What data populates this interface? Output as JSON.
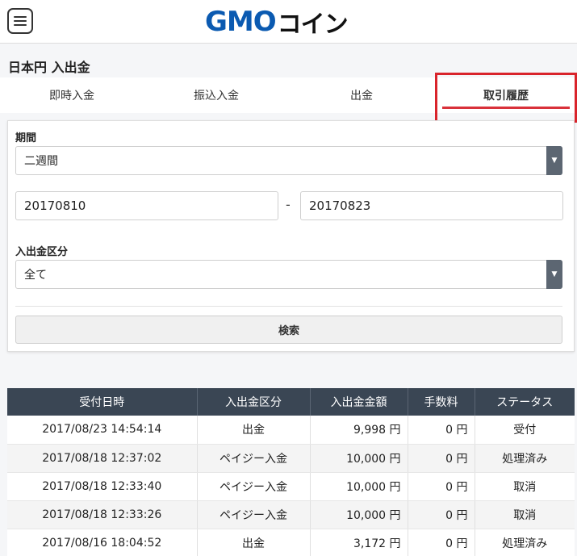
{
  "header": {
    "logo_gmo": "GMO",
    "logo_coin": "コイン"
  },
  "page": {
    "title": "日本円 入出金"
  },
  "tabs": [
    {
      "label": "即時入金"
    },
    {
      "label": "振込入金"
    },
    {
      "label": "出金"
    },
    {
      "label": "取引履歴",
      "active": true
    }
  ],
  "filter": {
    "period_label": "期間",
    "period_value": "二週間",
    "date_from": "20170810",
    "date_separator": "-",
    "date_to": "20170823",
    "type_label": "入出金区分",
    "type_value": "全て",
    "search_label": "検索"
  },
  "table": {
    "headers": [
      "受付日時",
      "入出金区分",
      "入出金金額",
      "手数料",
      "ステータス"
    ],
    "rows": [
      [
        "2017/08/23 14:54:14",
        "出金",
        "9,998 円",
        "0 円",
        "受付"
      ],
      [
        "2017/08/18 12:37:02",
        "ペイジー入金",
        "10,000 円",
        "0 円",
        "処理済み"
      ],
      [
        "2017/08/18 12:33:40",
        "ペイジー入金",
        "10,000 円",
        "0 円",
        "取消"
      ],
      [
        "2017/08/18 12:33:26",
        "ペイジー入金",
        "10,000 円",
        "0 円",
        "取消"
      ],
      [
        "2017/08/16 18:04:52",
        "出金",
        "3,172 円",
        "0 円",
        "処理済み"
      ]
    ]
  },
  "colors": {
    "brand_blue": "#0b5ab1",
    "accent_red": "#d9313a",
    "table_header": "#3a4654"
  }
}
